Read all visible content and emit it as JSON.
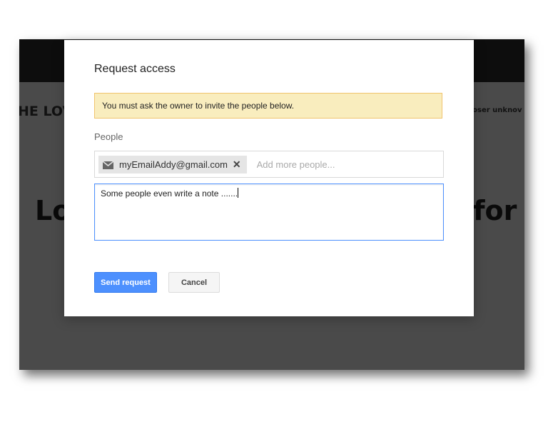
{
  "background": {
    "title_left": "HE LOV",
    "title_right": "poser unknov",
    "big_left": "Lo",
    "big_right": "for"
  },
  "dialog": {
    "title": "Request access",
    "notice": "You must ask the owner to invite the people below.",
    "people_label": "People",
    "chips": [
      {
        "email": "myEmailAddy@gmail.com",
        "icon": "mail-icon",
        "remove_glyph": "✕"
      }
    ],
    "add_placeholder": "Add more people...",
    "note_text": "Some people even write a note .......",
    "buttons": {
      "send": "Send request",
      "cancel": "Cancel"
    }
  },
  "colors": {
    "primary": "#4d90fe",
    "notice_bg": "#f9edbe",
    "notice_border": "#f0c36d"
  }
}
